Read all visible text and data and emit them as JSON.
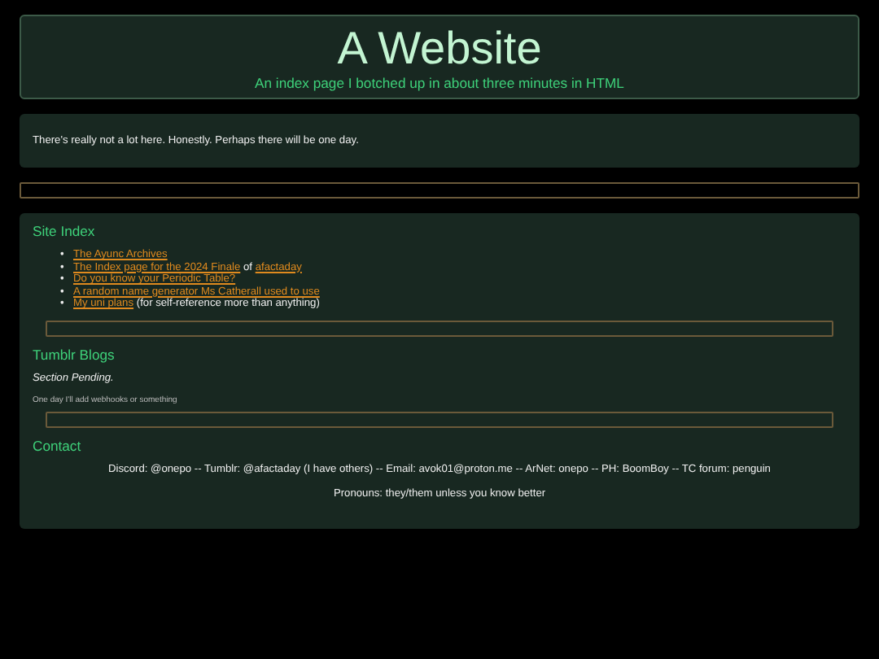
{
  "header": {
    "title": "A Website",
    "subtitle": "An index page I botched up in about three minutes in HTML"
  },
  "intro": {
    "text": "There's really not a lot here. Honestly. Perhaps there will be one day."
  },
  "sections": [
    {
      "heading": "Site Index",
      "kind": "list",
      "items": [
        {
          "bullet": "•",
          "parts": [
            {
              "kind": "link",
              "text": "The Ayunc Archives"
            }
          ]
        },
        {
          "bullet": "•",
          "parts": [
            {
              "kind": "link",
              "text": "The Index page for the 2024 Finale"
            },
            {
              "kind": "text",
              "text": "of"
            },
            {
              "kind": "link",
              "text": "afactaday"
            }
          ]
        },
        {
          "bullet": "•",
          "parts": [
            {
              "kind": "link",
              "text": "Do you know your Periodic Table?"
            }
          ]
        },
        {
          "bullet": "•",
          "parts": [
            {
              "kind": "link",
              "text": "A random name generator Ms Catherall used to use"
            }
          ]
        },
        {
          "bullet": "•",
          "parts": [
            {
              "kind": "link",
              "text": "My uni plans"
            },
            {
              "kind": "text",
              "text": "(for self-reference more than anything)"
            }
          ]
        }
      ]
    },
    {
      "heading": "Tumblr Blogs",
      "kind": "pending",
      "status": "Section Pending.",
      "note": "One day I'll add webhooks or something"
    },
    {
      "heading": "Contact",
      "kind": "contact",
      "lines": [
        "Discord: @onepo -- Tumblr: @afactaday (I have others) -- Email: avok01@proton.me -- ArNet: onepo -- PH: BoomBoy -- TC forum: penguin",
        "Pronouns: they/them unless you know better"
      ]
    }
  ]
}
